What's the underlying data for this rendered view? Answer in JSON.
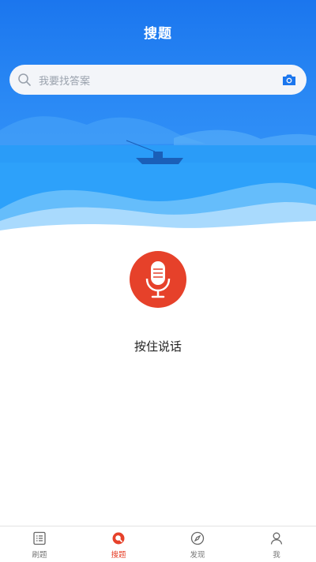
{
  "header": {
    "title": "搜题"
  },
  "search": {
    "placeholder": "我要找答案",
    "icon": "search-icon",
    "camera_icon": "camera-icon"
  },
  "voice": {
    "label": "按住说话",
    "icon": "microphone-icon",
    "color": "#e6412a"
  },
  "tabs": [
    {
      "label": "刷题",
      "icon": "list-icon",
      "active": false
    },
    {
      "label": "搜题",
      "icon": "search-tab-icon",
      "active": true
    },
    {
      "label": "发现",
      "icon": "compass-icon",
      "active": false
    },
    {
      "label": "我",
      "icon": "user-icon",
      "active": false
    }
  ],
  "colors": {
    "accent": "#e6412a",
    "brand_blue": "#1b76ee"
  }
}
